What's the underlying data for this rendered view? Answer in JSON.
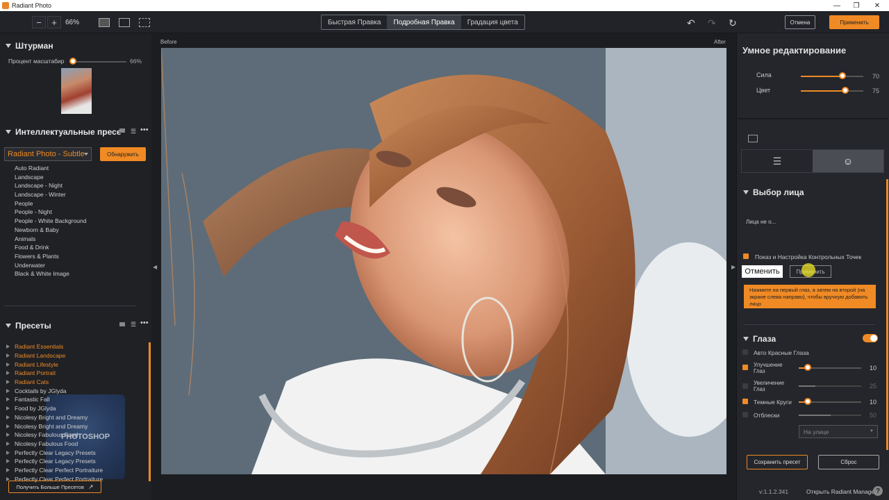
{
  "titlebar": {
    "title": "Radiant Photo"
  },
  "toolbar": {
    "zoom_minus": "−",
    "zoom_plus": "+",
    "zoom_value": "66%",
    "tabs": [
      {
        "label": "Быстрая Правка",
        "active": false
      },
      {
        "label": "Подробная Правка",
        "active": true
      },
      {
        "label": "Градация цвета",
        "active": false
      }
    ],
    "cancel_label": "Отмена",
    "apply_label": "Применить"
  },
  "navigator": {
    "title": "Штурман",
    "zoom_label": "Процент масштабир",
    "zoom_value": "66%",
    "zoom_percent": 66
  },
  "smart_presets": {
    "title": "Интеллектуальные пресе",
    "selected": "Radiant Photo - Subtle",
    "detect_label": "Обнаружить",
    "items": [
      "Auto Radiant",
      "Landscape",
      "Landscape - Night",
      "Landscape - Winter",
      "People",
      "People - Night",
      "People - White Background",
      "Newborn & Baby",
      "Animals",
      "Food & Drink",
      "Flowers & Plants",
      "Underwater",
      "Black & White Image"
    ]
  },
  "presets": {
    "title": "Пресеты",
    "items": [
      {
        "label": "Radiant Essentials",
        "highlight": true
      },
      {
        "label": "Radiant Landscape",
        "highlight": true
      },
      {
        "label": "Radiant Lifestyle",
        "highlight": true
      },
      {
        "label": "Radiant Portrait",
        "highlight": true
      },
      {
        "label": "Radiant Cats",
        "highlight": true
      },
      {
        "label": "Cocktails by JGlyda",
        "highlight": false
      },
      {
        "label": "Fantastic Fall",
        "highlight": false
      },
      {
        "label": "Food by JGlyda",
        "highlight": false
      },
      {
        "label": "Nicolesy Bright and Dreamy",
        "highlight": false
      },
      {
        "label": "Nicolesy Bright and Dreamy",
        "highlight": false
      },
      {
        "label": "Nicolesy Fabulous Food",
        "highlight": false
      },
      {
        "label": "Nicolesy Fabulous Food",
        "highlight": false
      },
      {
        "label": "Perfectly Clear Legacy Presets",
        "highlight": false
      },
      {
        "label": "Perfectly Clear Legacy Presets",
        "highlight": false
      },
      {
        "label": "Perfectly Clear Perfect Portraiture",
        "highlight": false
      },
      {
        "label": "Perfectly Clear Perfect Portraiture",
        "highlight": false
      }
    ],
    "watermark": "PHOTOSHOP",
    "more_label": "Получить Больше Пресетов"
  },
  "canvas": {
    "before_label": "Before",
    "after_label": "After"
  },
  "smart_edit": {
    "title": "Умное редактирование",
    "strength_label": "Сила",
    "strength_value": "70",
    "color_label": "Цвет",
    "color_value": "75"
  },
  "face_select": {
    "title": "Выбор лица",
    "status": "Лица не о...",
    "show_points_label": "Показ и Настройка Контрольных Точек",
    "cancel_label": "Отменить",
    "apply_label": "Применить",
    "tip": "Нажмите на первый глаз, а затем на второй (на экране слева направо), чтобы вручную добавить лицо"
  },
  "eyes": {
    "title": "Глаза",
    "red_eye_label": "Авто Красные Глаза",
    "enhance_label": "Улучшение Глаз",
    "enhance_value": "10",
    "enlarge_label": "Увеличение Глаз",
    "enlarge_value": "25",
    "dark_circles_label": "Темные Круги",
    "dark_circles_value": "10",
    "glare_label": "Отблески",
    "glare_value": "50",
    "glare_mode": "На улице"
  },
  "footer": {
    "save_preset_label": "Сохранить пресет",
    "reset_label": "Сброс",
    "version": "v:1.1.2.341",
    "open_manager_label": "Открыть Radiant Manager",
    "help": "?"
  },
  "colors": {
    "accent": "#f08a24",
    "panel": "#1f2125",
    "canvas": "#1b1d21"
  }
}
